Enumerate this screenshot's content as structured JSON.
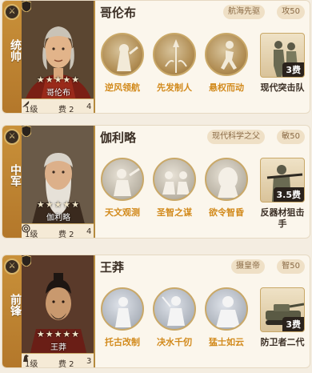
{
  "heroes": [
    {
      "role": "统帅",
      "role_icon": "crossed-swords-icon",
      "name": "哥伦布",
      "title_tag": "航海先驱",
      "stat_tag": "攻50",
      "stars": "★★★★★",
      "portrait_name": "哥伦布",
      "level": "1级",
      "cost": "费 2",
      "foot_icon": "feather-icon",
      "foot_count": "4",
      "skills": [
        "逆风领航",
        "先发制人",
        "悬权而动"
      ],
      "unit": {
        "name": "现代突击队",
        "cost": "3费"
      }
    },
    {
      "role": "中军",
      "role_icon": "crossed-swords-icon",
      "name": "伽利略",
      "title_tag": "现代科学之父",
      "stat_tag": "敏50",
      "stars": "★★★★★",
      "portrait_name": "伽利略",
      "level": "1级",
      "cost": "费 2",
      "foot_icon": "target-icon",
      "foot_count": "4",
      "skills": [
        "天文观测",
        "圣智之谋",
        "欲令智昏"
      ],
      "unit": {
        "name": "反器材狙击手",
        "cost": "3.5费"
      }
    },
    {
      "role": "前锋",
      "role_icon": "crossed-swords-icon",
      "name": "王莽",
      "title_tag": "摄皇帝",
      "stat_tag": "智50",
      "stars": "★★★★★",
      "portrait_name": "王莽",
      "level": "1级",
      "cost": "费 2",
      "foot_icon": "horse-icon",
      "foot_count": "3",
      "skills": [
        "托古改制",
        "决水千仞",
        "猛士如云"
      ],
      "unit": {
        "name": "防卫者二代",
        "cost": "3费"
      }
    }
  ]
}
